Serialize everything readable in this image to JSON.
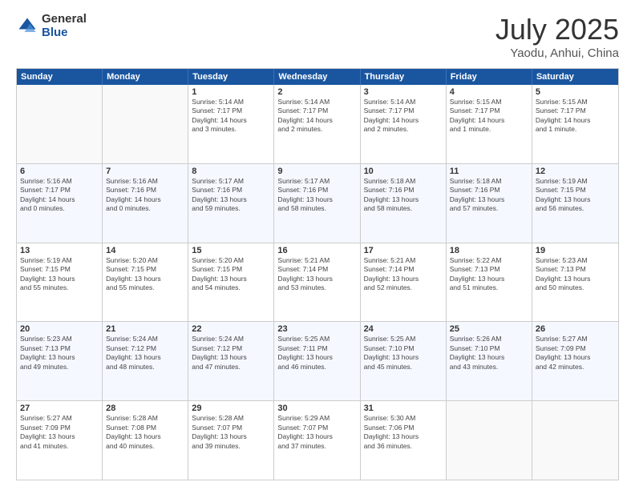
{
  "logo": {
    "general": "General",
    "blue": "Blue"
  },
  "header": {
    "month": "July 2025",
    "location": "Yaodu, Anhui, China"
  },
  "weekdays": [
    "Sunday",
    "Monday",
    "Tuesday",
    "Wednesday",
    "Thursday",
    "Friday",
    "Saturday"
  ],
  "weeks": [
    [
      {
        "day": "",
        "info": ""
      },
      {
        "day": "",
        "info": ""
      },
      {
        "day": "1",
        "info": "Sunrise: 5:14 AM\nSunset: 7:17 PM\nDaylight: 14 hours\nand 3 minutes."
      },
      {
        "day": "2",
        "info": "Sunrise: 5:14 AM\nSunset: 7:17 PM\nDaylight: 14 hours\nand 2 minutes."
      },
      {
        "day": "3",
        "info": "Sunrise: 5:14 AM\nSunset: 7:17 PM\nDaylight: 14 hours\nand 2 minutes."
      },
      {
        "day": "4",
        "info": "Sunrise: 5:15 AM\nSunset: 7:17 PM\nDaylight: 14 hours\nand 1 minute."
      },
      {
        "day": "5",
        "info": "Sunrise: 5:15 AM\nSunset: 7:17 PM\nDaylight: 14 hours\nand 1 minute."
      }
    ],
    [
      {
        "day": "6",
        "info": "Sunrise: 5:16 AM\nSunset: 7:17 PM\nDaylight: 14 hours\nand 0 minutes."
      },
      {
        "day": "7",
        "info": "Sunrise: 5:16 AM\nSunset: 7:16 PM\nDaylight: 14 hours\nand 0 minutes."
      },
      {
        "day": "8",
        "info": "Sunrise: 5:17 AM\nSunset: 7:16 PM\nDaylight: 13 hours\nand 59 minutes."
      },
      {
        "day": "9",
        "info": "Sunrise: 5:17 AM\nSunset: 7:16 PM\nDaylight: 13 hours\nand 58 minutes."
      },
      {
        "day": "10",
        "info": "Sunrise: 5:18 AM\nSunset: 7:16 PM\nDaylight: 13 hours\nand 58 minutes."
      },
      {
        "day": "11",
        "info": "Sunrise: 5:18 AM\nSunset: 7:16 PM\nDaylight: 13 hours\nand 57 minutes."
      },
      {
        "day": "12",
        "info": "Sunrise: 5:19 AM\nSunset: 7:15 PM\nDaylight: 13 hours\nand 56 minutes."
      }
    ],
    [
      {
        "day": "13",
        "info": "Sunrise: 5:19 AM\nSunset: 7:15 PM\nDaylight: 13 hours\nand 55 minutes."
      },
      {
        "day": "14",
        "info": "Sunrise: 5:20 AM\nSunset: 7:15 PM\nDaylight: 13 hours\nand 55 minutes."
      },
      {
        "day": "15",
        "info": "Sunrise: 5:20 AM\nSunset: 7:15 PM\nDaylight: 13 hours\nand 54 minutes."
      },
      {
        "day": "16",
        "info": "Sunrise: 5:21 AM\nSunset: 7:14 PM\nDaylight: 13 hours\nand 53 minutes."
      },
      {
        "day": "17",
        "info": "Sunrise: 5:21 AM\nSunset: 7:14 PM\nDaylight: 13 hours\nand 52 minutes."
      },
      {
        "day": "18",
        "info": "Sunrise: 5:22 AM\nSunset: 7:13 PM\nDaylight: 13 hours\nand 51 minutes."
      },
      {
        "day": "19",
        "info": "Sunrise: 5:23 AM\nSunset: 7:13 PM\nDaylight: 13 hours\nand 50 minutes."
      }
    ],
    [
      {
        "day": "20",
        "info": "Sunrise: 5:23 AM\nSunset: 7:13 PM\nDaylight: 13 hours\nand 49 minutes."
      },
      {
        "day": "21",
        "info": "Sunrise: 5:24 AM\nSunset: 7:12 PM\nDaylight: 13 hours\nand 48 minutes."
      },
      {
        "day": "22",
        "info": "Sunrise: 5:24 AM\nSunset: 7:12 PM\nDaylight: 13 hours\nand 47 minutes."
      },
      {
        "day": "23",
        "info": "Sunrise: 5:25 AM\nSunset: 7:11 PM\nDaylight: 13 hours\nand 46 minutes."
      },
      {
        "day": "24",
        "info": "Sunrise: 5:25 AM\nSunset: 7:10 PM\nDaylight: 13 hours\nand 45 minutes."
      },
      {
        "day": "25",
        "info": "Sunrise: 5:26 AM\nSunset: 7:10 PM\nDaylight: 13 hours\nand 43 minutes."
      },
      {
        "day": "26",
        "info": "Sunrise: 5:27 AM\nSunset: 7:09 PM\nDaylight: 13 hours\nand 42 minutes."
      }
    ],
    [
      {
        "day": "27",
        "info": "Sunrise: 5:27 AM\nSunset: 7:09 PM\nDaylight: 13 hours\nand 41 minutes."
      },
      {
        "day": "28",
        "info": "Sunrise: 5:28 AM\nSunset: 7:08 PM\nDaylight: 13 hours\nand 40 minutes."
      },
      {
        "day": "29",
        "info": "Sunrise: 5:28 AM\nSunset: 7:07 PM\nDaylight: 13 hours\nand 39 minutes."
      },
      {
        "day": "30",
        "info": "Sunrise: 5:29 AM\nSunset: 7:07 PM\nDaylight: 13 hours\nand 37 minutes."
      },
      {
        "day": "31",
        "info": "Sunrise: 5:30 AM\nSunset: 7:06 PM\nDaylight: 13 hours\nand 36 minutes."
      },
      {
        "day": "",
        "info": ""
      },
      {
        "day": "",
        "info": ""
      }
    ]
  ]
}
